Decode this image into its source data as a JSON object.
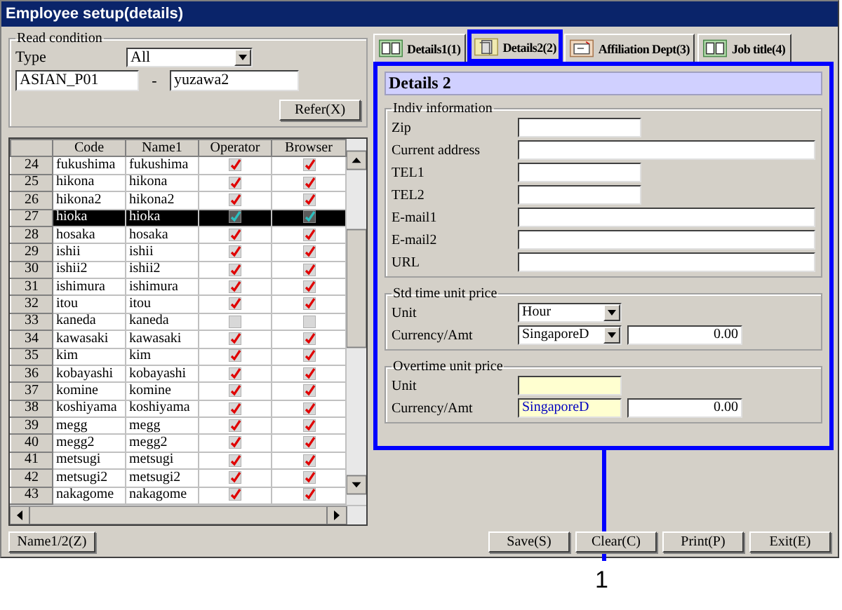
{
  "window": {
    "title": "Employee setup(details)"
  },
  "read_condition": {
    "title": "Read condition",
    "type_label": "Type",
    "type_value": "All",
    "from": "ASIAN_P01",
    "separator": "-",
    "to": "yuzawa2",
    "refer_button": "Refer(X)"
  },
  "grid": {
    "columns": [
      "Code",
      "Name1",
      "Operator",
      "Browser"
    ],
    "rows": [
      {
        "num": "24",
        "code": "fukushima",
        "name1": "fukushima",
        "operator": true,
        "browser": true,
        "selected": false
      },
      {
        "num": "25",
        "code": "hikona",
        "name1": "hikona",
        "operator": true,
        "browser": true,
        "selected": false
      },
      {
        "num": "26",
        "code": "hikona2",
        "name1": "hikona2",
        "operator": true,
        "browser": true,
        "selected": false
      },
      {
        "num": "27",
        "code": "hioka",
        "name1": "hioka",
        "operator": true,
        "browser": true,
        "selected": true
      },
      {
        "num": "28",
        "code": "hosaka",
        "name1": "hosaka",
        "operator": true,
        "browser": true,
        "selected": false
      },
      {
        "num": "29",
        "code": "ishii",
        "name1": "ishii",
        "operator": true,
        "browser": true,
        "selected": false
      },
      {
        "num": "30",
        "code": "ishii2",
        "name1": "ishii2",
        "operator": true,
        "browser": true,
        "selected": false
      },
      {
        "num": "31",
        "code": "ishimura",
        "name1": "ishimura",
        "operator": true,
        "browser": true,
        "selected": false
      },
      {
        "num": "32",
        "code": "itou",
        "name1": "itou",
        "operator": true,
        "browser": true,
        "selected": false
      },
      {
        "num": "33",
        "code": "kaneda",
        "name1": "kaneda",
        "operator": false,
        "browser": false,
        "selected": false
      },
      {
        "num": "34",
        "code": "kawasaki",
        "name1": "kawasaki",
        "operator": true,
        "browser": true,
        "selected": false
      },
      {
        "num": "35",
        "code": "kim",
        "name1": "kim",
        "operator": true,
        "browser": true,
        "selected": false
      },
      {
        "num": "36",
        "code": "kobayashi",
        "name1": "kobayashi",
        "operator": true,
        "browser": true,
        "selected": false
      },
      {
        "num": "37",
        "code": "komine",
        "name1": "komine",
        "operator": true,
        "browser": true,
        "selected": false
      },
      {
        "num": "38",
        "code": "koshiyama",
        "name1": "koshiyama",
        "operator": true,
        "browser": true,
        "selected": false
      },
      {
        "num": "39",
        "code": "megg",
        "name1": "megg",
        "operator": true,
        "browser": true,
        "selected": false
      },
      {
        "num": "40",
        "code": "megg2",
        "name1": "megg2",
        "operator": true,
        "browser": true,
        "selected": false
      },
      {
        "num": "41",
        "code": "metsugi",
        "name1": "metsugi",
        "operator": true,
        "browser": true,
        "selected": false
      },
      {
        "num": "42",
        "code": "metsugi2",
        "name1": "metsugi2",
        "operator": true,
        "browser": true,
        "selected": false
      },
      {
        "num": "43",
        "code": "nakagome",
        "name1": "nakagome",
        "operator": true,
        "browser": true,
        "selected": false
      }
    ]
  },
  "name_button": "Name1/2(Z)",
  "tabs": [
    {
      "label": "Details1(1)",
      "kind": "book",
      "selected": false,
      "highlighted": false
    },
    {
      "label": "Details2(2)",
      "kind": "document",
      "selected": true,
      "highlighted": true
    },
    {
      "label": "Affiliation Dept(3)",
      "kind": "envelope",
      "selected": false,
      "highlighted": false
    },
    {
      "label": "Job title(4)",
      "kind": "book",
      "selected": false,
      "highlighted": false
    }
  ],
  "panel": {
    "title": "Details 2",
    "highlighted": true,
    "indiv": {
      "title": "Indiv information",
      "fields": [
        {
          "label": "Zip",
          "kind": "short"
        },
        {
          "label": "Current address",
          "kind": "long"
        },
        {
          "label": "TEL1",
          "kind": "short"
        },
        {
          "label": "TEL2",
          "kind": "short"
        },
        {
          "label": "E-mail1",
          "kind": "long"
        },
        {
          "label": "E-mail2",
          "kind": "long"
        },
        {
          "label": "URL",
          "kind": "long"
        }
      ]
    },
    "std": {
      "title": "Std time unit price",
      "unit_label": "Unit",
      "unit": "Hour",
      "currency_label": "Currency/Amt",
      "currency": "SingaporeD",
      "amount": "0.00"
    },
    "overtime": {
      "title": "Overtime unit price",
      "unit_label": "Unit",
      "currency_label": "Currency/Amt",
      "currency": "SingaporeD",
      "amount": "0.00"
    }
  },
  "buttons": [
    "Save(S)",
    "Clear(C)",
    "Print(P)",
    "Exit(E)"
  ],
  "callouts": [
    {
      "label": "1"
    }
  ]
}
